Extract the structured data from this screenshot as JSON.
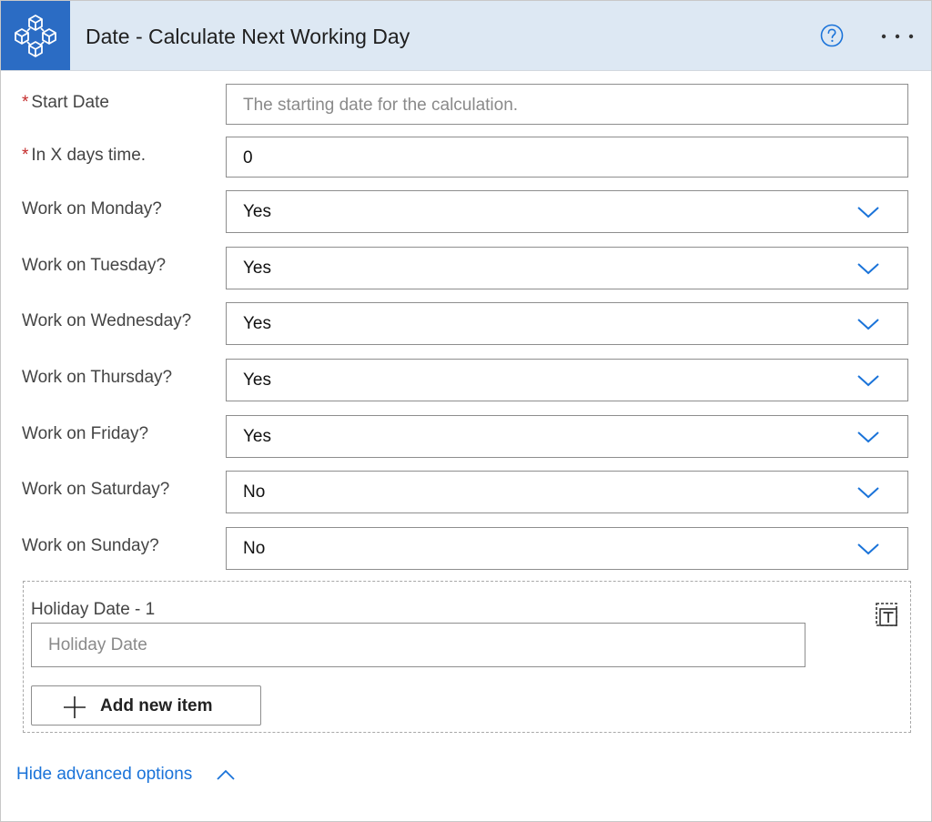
{
  "header": {
    "title": "Date - Calculate Next Working Day",
    "logo_icon": "connector-cubes-icon",
    "help_icon": "help-circle-icon",
    "more_icon": "more-dots-icon",
    "logo_color": "#2b6cc4",
    "header_bg": "#dde8f3"
  },
  "fields": {
    "start_date": {
      "label": "Start Date",
      "required_mark": "*",
      "placeholder": "The starting date for the calculation.",
      "value": ""
    },
    "days": {
      "label": "In X days time.",
      "required_mark": "*",
      "value": "0"
    },
    "monday": {
      "label": "Work on Monday?",
      "value": "Yes"
    },
    "tuesday": {
      "label": "Work on Tuesday?",
      "value": "Yes"
    },
    "wednesday": {
      "label": "Work on Wednesday?",
      "value": "Yes"
    },
    "thursday": {
      "label": "Work on Thursday?",
      "value": "Yes"
    },
    "friday": {
      "label": "Work on Friday?",
      "value": "Yes"
    },
    "saturday": {
      "label": "Work on Saturday?",
      "value": "No"
    },
    "sunday": {
      "label": "Work on Sunday?",
      "value": "No"
    }
  },
  "holidays": {
    "item_label": "Holiday Date - 1",
    "placeholder": "Holiday Date",
    "value": "",
    "add_label": "Add new item",
    "remove_icon": "remove-item-icon",
    "add_icon": "plus-icon"
  },
  "footer": {
    "toggle_label": "Hide advanced options",
    "toggle_icon": "chevron-up-icon",
    "link_color": "#1a73d9"
  }
}
